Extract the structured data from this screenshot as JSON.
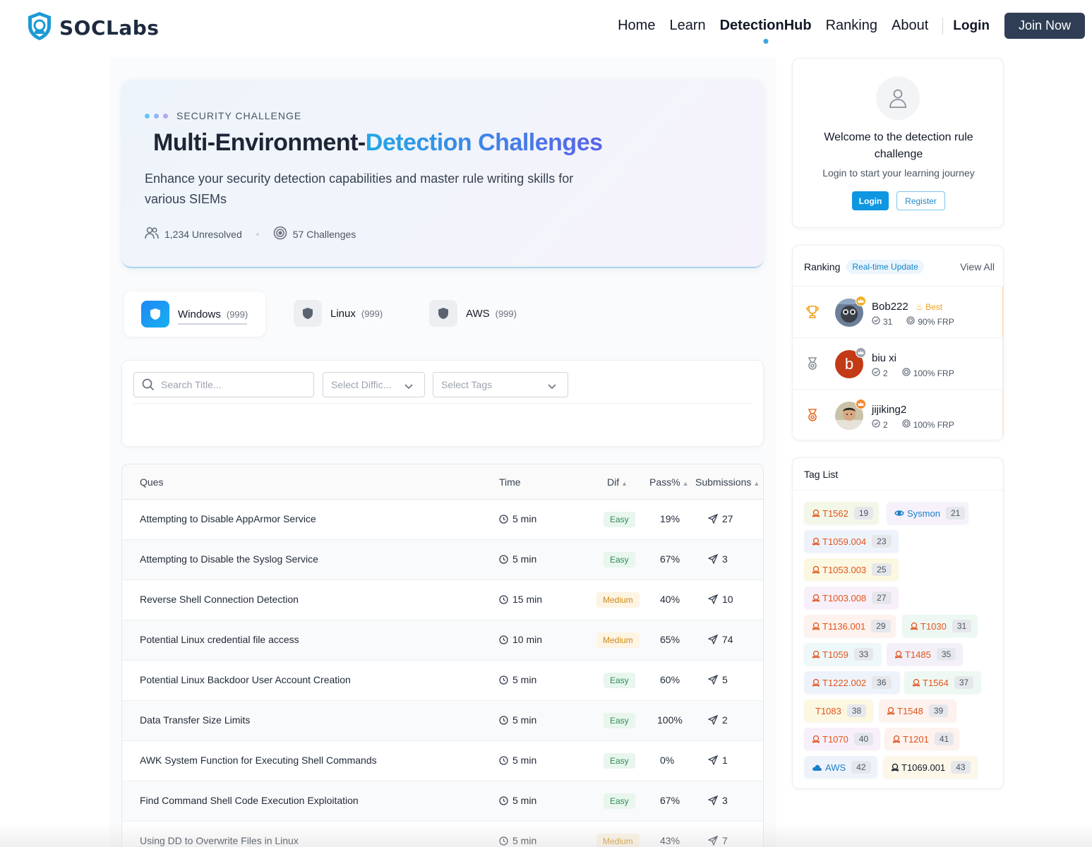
{
  "nav": {
    "brand": "SOCLabs",
    "links": [
      "Home",
      "Learn",
      "DetectionHub",
      "Ranking",
      "About"
    ],
    "login": "Login",
    "join": "Join Now"
  },
  "hero": {
    "tag": "SECURITY CHALLENGE",
    "title_part1": "Multi-Environment-",
    "title_part2": "Detection Challenges",
    "subtitle": "Enhance your security detection capabilities and master rule writing skills for various SIEMs",
    "unresolved": "1,234 Unresolved",
    "challenges": "57 Challenges"
  },
  "env_tabs": [
    {
      "label": "Windows",
      "count": "(999)"
    },
    {
      "label": "Linux",
      "count": "(999)"
    },
    {
      "label": "AWS",
      "count": "(999)"
    }
  ],
  "filters": {
    "search_placeholder": "Search Title...",
    "difficulty_placeholder": "Select Diffic...",
    "tags_placeholder": "Select Tags"
  },
  "table": {
    "headers": {
      "ques": "Ques",
      "time": "Time",
      "dif": "Dif",
      "pass": "Pass%",
      "submissions": "Submissions"
    },
    "rows": [
      {
        "title": "Attempting to Disable AppArmor Service",
        "time": "5 min",
        "dif": "Easy",
        "pass": "19%",
        "subs": "27"
      },
      {
        "title": "Attempting to Disable the Syslog Service",
        "time": "5 min",
        "dif": "Easy",
        "pass": "67%",
        "subs": "3"
      },
      {
        "title": "Reverse Shell Connection Detection",
        "time": "15 min",
        "dif": "Medium",
        "pass": "40%",
        "subs": "10"
      },
      {
        "title": "Potential Linux credential file access",
        "time": "10 min",
        "dif": "Medium",
        "pass": "65%",
        "subs": "74"
      },
      {
        "title": "Potential Linux Backdoor User Account Creation",
        "time": "5 min",
        "dif": "Easy",
        "pass": "60%",
        "subs": "5"
      },
      {
        "title": "Data Transfer Size Limits",
        "time": "5 min",
        "dif": "Easy",
        "pass": "100%",
        "subs": "2"
      },
      {
        "title": "AWK System Function for Executing Shell Commands",
        "time": "5 min",
        "dif": "Easy",
        "pass": "0%",
        "subs": "1"
      },
      {
        "title": "Find Command Shell Code Execution Exploitation",
        "time": "5 min",
        "dif": "Easy",
        "pass": "67%",
        "subs": "3"
      },
      {
        "title": "Using DD to Overwrite Files in Linux",
        "time": "5 min",
        "dif": "Medium",
        "pass": "43%",
        "subs": "7"
      }
    ]
  },
  "welcome": {
    "title": "Welcome to the detection rule challenge",
    "subtitle": "Login to start your learning journey",
    "login": "Login",
    "register": "Register"
  },
  "ranking": {
    "title": "Ranking",
    "pill": "Real-time Update",
    "view_all": "View All",
    "best_label": "Best",
    "users": [
      {
        "name": "Bob222",
        "solved": "31",
        "frp": "90% FRP",
        "initial": ""
      },
      {
        "name": "biu xi",
        "solved": "2",
        "frp": "100% FRP",
        "initial": "b"
      },
      {
        "name": "jijiking2",
        "solved": "2",
        "frp": "100% FRP",
        "initial": ""
      }
    ]
  },
  "tags": {
    "title": "Tag List",
    "items": [
      {
        "label": "T1562",
        "count": "19"
      },
      {
        "label": "Sysmon",
        "count": "21"
      },
      {
        "label": "T1059.004",
        "count": "23"
      },
      {
        "label": "T1053.003",
        "count": "25"
      },
      {
        "label": "T1003.008",
        "count": "27"
      },
      {
        "label": "T1136.001",
        "count": "29"
      },
      {
        "label": "T1030",
        "count": "31"
      },
      {
        "label": "T1059",
        "count": "33"
      },
      {
        "label": "T1485",
        "count": "35"
      },
      {
        "label": "T1222.002",
        "count": "36"
      },
      {
        "label": "T1564",
        "count": "37"
      },
      {
        "label": "T1083",
        "count": "38"
      },
      {
        "label": "T1548",
        "count": "39"
      },
      {
        "label": "T1070",
        "count": "40"
      },
      {
        "label": "T1201",
        "count": "41"
      },
      {
        "label": "AWS",
        "count": "42"
      },
      {
        "label": "T1069.001",
        "count": "43"
      }
    ]
  },
  "colors": {
    "accent": "#0e96e0",
    "brand_dark": "#2f3e54",
    "easy": "#2f8a55",
    "medium": "#d08a14",
    "tag_text": "#e2541b"
  },
  "icons": {
    "logo": "shield-eye-icon",
    "users": "users-icon",
    "target": "target-icon",
    "clock": "clock-icon",
    "send": "send-icon",
    "search": "search-icon",
    "chevron": "chevron-down-icon",
    "trophy": "trophy-icon",
    "medal": "medal-icon",
    "skull": "skull-icon",
    "eye": "eye-icon",
    "cloud": "cloud-icon"
  }
}
